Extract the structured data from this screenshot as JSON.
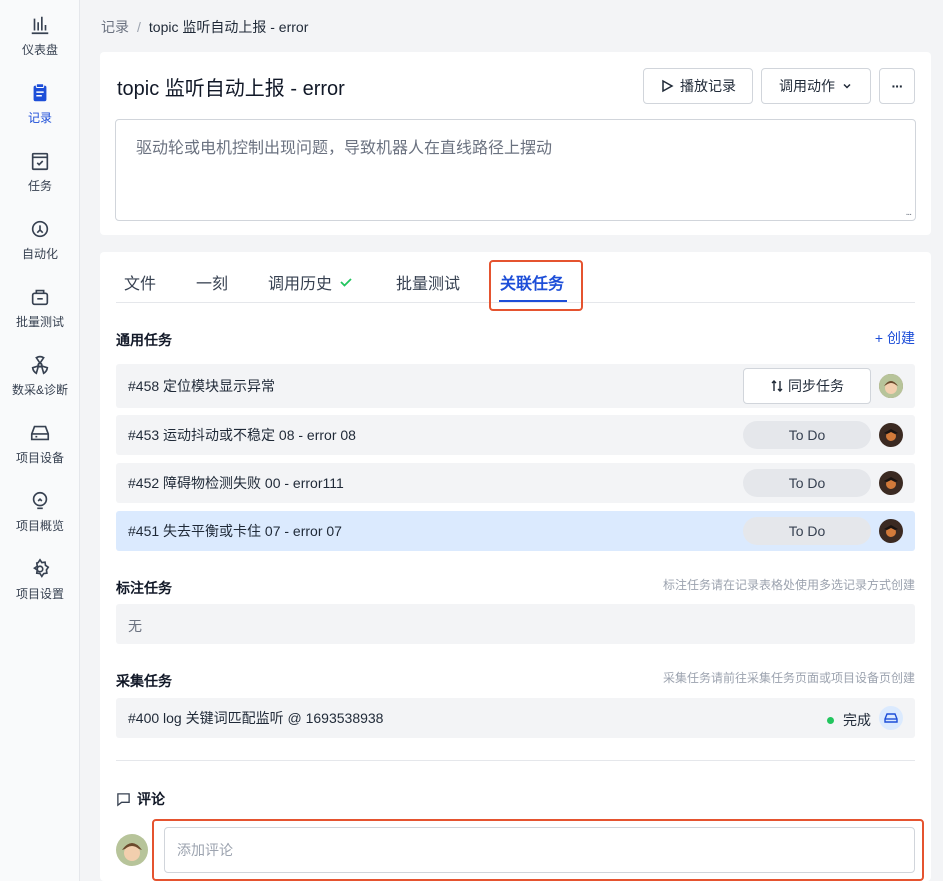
{
  "sidebar": {
    "items": [
      {
        "label": "仪表盘",
        "icon": "chart-bar-icon"
      },
      {
        "label": "记录",
        "icon": "record-doc-icon",
        "active": true
      },
      {
        "label": "任务",
        "icon": "task-check-icon"
      },
      {
        "label": "自动化",
        "icon": "automation-icon"
      },
      {
        "label": "批量测试",
        "icon": "batch-test-icon"
      },
      {
        "label": "数采&诊断",
        "icon": "radiation-icon"
      },
      {
        "label": "项目设备",
        "icon": "device-icon"
      },
      {
        "label": "项目概览",
        "icon": "overview-bulb-icon"
      },
      {
        "label": "项目设置",
        "icon": "gear-icon"
      }
    ]
  },
  "breadcrumb": {
    "parent": "记录",
    "separator": "/",
    "current": "topic 监听自动上报 - error"
  },
  "header": {
    "title": "topic 监听自动上报 - error",
    "play_label": "播放记录",
    "action_label": "调用动作",
    "more_label": "···",
    "description": "驱动轮或电机控制出现问题，导致机器人在直线路径上摆动",
    "resize_mark": "..."
  },
  "tabs": [
    {
      "label": "文件"
    },
    {
      "label": "一刻"
    },
    {
      "label": "调用历史"
    },
    {
      "label": "批量测试"
    },
    {
      "label": "关联任务",
      "active": true
    }
  ],
  "general_tasks": {
    "title": "通用任务",
    "create_label": "+ 创建",
    "rows": [
      {
        "text": "#458 定位模块显示异常",
        "action": "同步任务"
      },
      {
        "text": "#453 运动抖动或不稳定 08 - error 08",
        "status": "To Do"
      },
      {
        "text": "#452 障碍物检测失败 00 - error111",
        "status": "To Do"
      },
      {
        "text": "#451 失去平衡或卡住 07 - error 07",
        "status": "To Do",
        "selected": true
      }
    ]
  },
  "annotation_tasks": {
    "title": "标注任务",
    "note": "标注任务请在记录表格处使用多选记录方式创建",
    "empty": "无"
  },
  "collection_tasks": {
    "title": "采集任务",
    "note": "采集任务请前往采集任务页面或项目设备页创建",
    "rows": [
      {
        "text": "#400 log 关键词匹配监听 @ 1693538938",
        "status": "完成"
      }
    ]
  },
  "comments": {
    "title": "评论",
    "placeholder": "添加评论"
  },
  "colors": {
    "accent": "#1d4ed8",
    "highlight_border": "#e5532f",
    "success": "#22c55e"
  }
}
